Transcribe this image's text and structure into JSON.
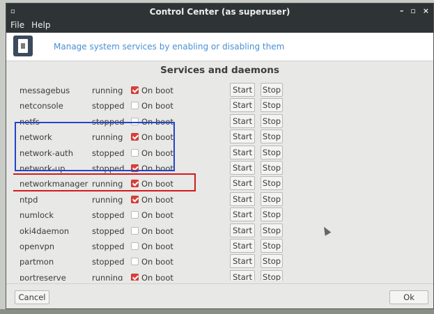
{
  "window": {
    "title": "Control Center (as superuser)",
    "icon": "▫",
    "controls": {
      "minimize": "–",
      "maximize": "▫",
      "close": "×"
    }
  },
  "menu": {
    "file": "File",
    "help": "Help"
  },
  "banner": {
    "description": "Manage system services by enabling or disabling them"
  },
  "section_title": "Services and daemons",
  "checkbox_label": "On boot",
  "buttons": {
    "start": "Start",
    "stop": "Stop",
    "cancel": "Cancel",
    "ok": "Ok"
  },
  "services": [
    {
      "name": "messagebus",
      "status": "running",
      "on_boot": true
    },
    {
      "name": "netconsole",
      "status": "stopped",
      "on_boot": false
    },
    {
      "name": "netfs",
      "status": "stopped",
      "on_boot": false
    },
    {
      "name": "network",
      "status": "running",
      "on_boot": true
    },
    {
      "name": "network-auth",
      "status": "stopped",
      "on_boot": false
    },
    {
      "name": "network-up",
      "status": "stopped",
      "on_boot": true
    },
    {
      "name": "networkmanager",
      "status": "running",
      "on_boot": true
    },
    {
      "name": "ntpd",
      "status": "running",
      "on_boot": true
    },
    {
      "name": "numlock",
      "status": "stopped",
      "on_boot": false
    },
    {
      "name": "oki4daemon",
      "status": "stopped",
      "on_boot": false
    },
    {
      "name": "openvpn",
      "status": "stopped",
      "on_boot": false
    },
    {
      "name": "partmon",
      "status": "stopped",
      "on_boot": false
    },
    {
      "name": "portreserve",
      "status": "running",
      "on_boot": true
    }
  ],
  "colors": {
    "accent_link": "#4a8fd4",
    "checkbox_checked": "#d9413a",
    "highlight_blue": "#2046c8",
    "highlight_red": "#d11a1a"
  }
}
